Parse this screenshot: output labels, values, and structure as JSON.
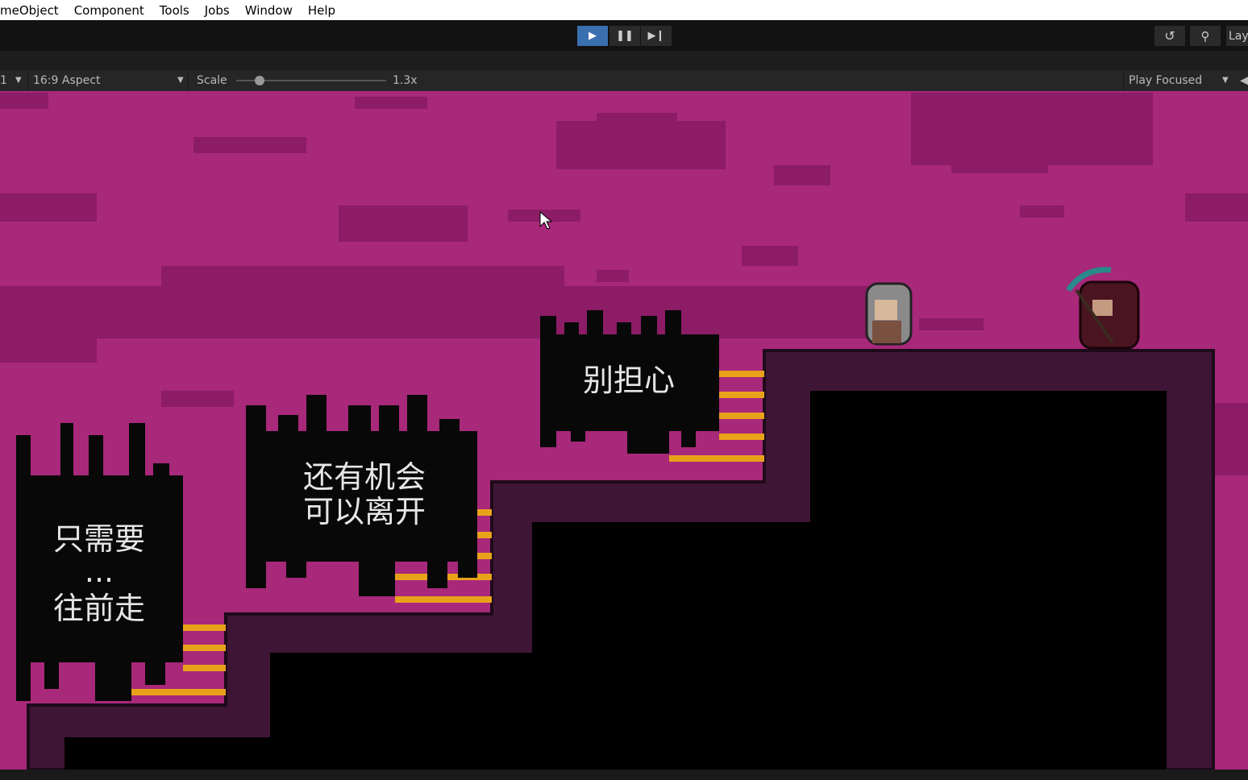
{
  "menu": [
    "meObject",
    "Component",
    "Tools",
    "Jobs",
    "Window",
    "Help"
  ],
  "toolbar": {
    "play_icon": "play-icon",
    "pause_icon": "pause-icon",
    "step_icon": "step-icon",
    "history_icon": "history-icon",
    "search_icon": "search-icon",
    "layout_label": "Lay"
  },
  "game_bar": {
    "display": "1",
    "aspect": "16:9 Aspect",
    "scale_label": "Scale",
    "scale_value": "1.3x",
    "play_mode": "Play Focused"
  },
  "scene": {
    "colors": {
      "sky": "#a8287a",
      "clouds": "#8c1c66",
      "ground_edge": "#3e1535",
      "ground_inner": "#000000",
      "stripes": "#e8a21a"
    },
    "signs": [
      {
        "lines": [
          "只需要",
          "...",
          "往前走"
        ]
      },
      {
        "lines": [
          "还有机会",
          "可以离开"
        ]
      },
      {
        "lines": [
          "别担心"
        ]
      }
    ]
  }
}
